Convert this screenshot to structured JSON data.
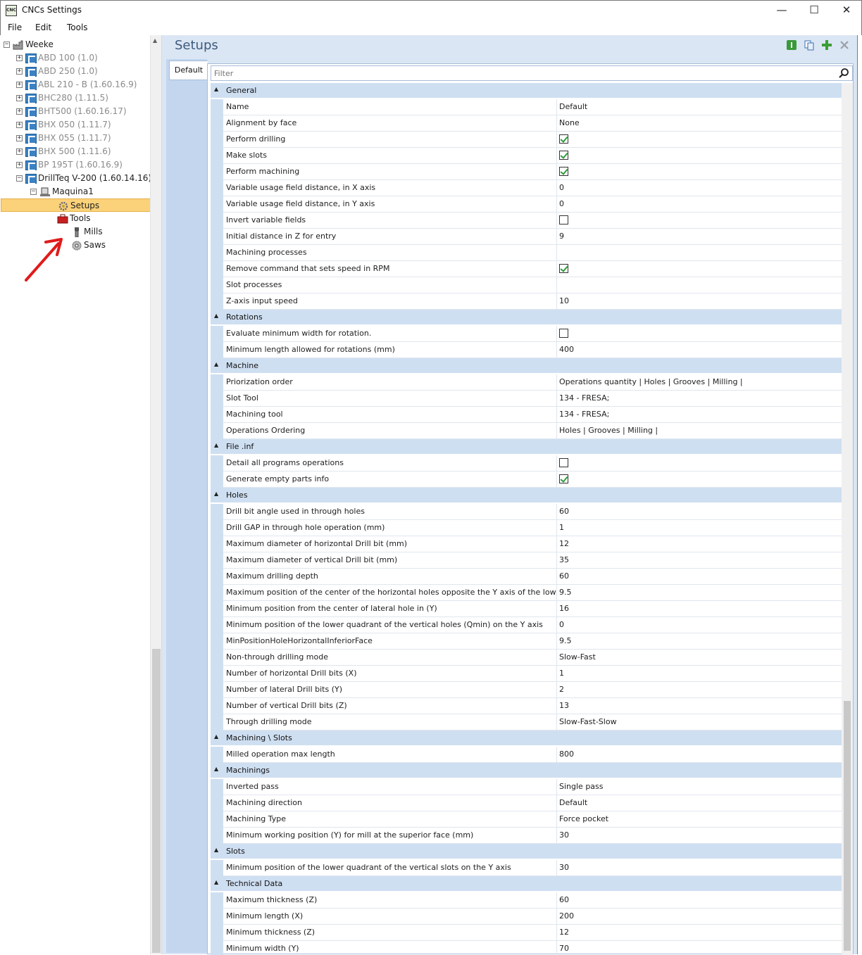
{
  "window": {
    "title": "CNCs Settings",
    "icon_text": "CNC"
  },
  "menu": [
    "File",
    "Edit",
    "Tools"
  ],
  "tree": [
    {
      "label": "Weeke",
      "level": 0,
      "expander": "−",
      "icon": "factory-icon",
      "disabled": false
    },
    {
      "label": "ABD 100 (1.0)",
      "level": 1,
      "expander": "+",
      "icon": "cnc-icon",
      "disabled": true
    },
    {
      "label": "ABD 250 (1.0)",
      "level": 1,
      "expander": "+",
      "icon": "cnc-icon",
      "disabled": true
    },
    {
      "label": "ABL 210 - B (1.60.16.9)",
      "level": 1,
      "expander": "+",
      "icon": "cnc-icon",
      "disabled": true
    },
    {
      "label": "BHC280 (1.11.5)",
      "level": 1,
      "expander": "+",
      "icon": "cnc-icon",
      "disabled": true
    },
    {
      "label": "BHT500 (1.60.16.17)",
      "level": 1,
      "expander": "+",
      "icon": "cnc-icon",
      "disabled": true
    },
    {
      "label": "BHX 050 (1.11.7)",
      "level": 1,
      "expander": "+",
      "icon": "cnc-icon",
      "disabled": true
    },
    {
      "label": "BHX 055 (1.11.7)",
      "level": 1,
      "expander": "+",
      "icon": "cnc-icon",
      "disabled": true
    },
    {
      "label": "BHX 500 (1.11.6)",
      "level": 1,
      "expander": "+",
      "icon": "cnc-icon",
      "disabled": true
    },
    {
      "label": "BP 195T (1.60.16.9)",
      "level": 1,
      "expander": "+",
      "icon": "cnc-icon",
      "disabled": true
    },
    {
      "label": "DrillTeq V-200 (1.60.14.16)",
      "level": 1,
      "expander": "−",
      "icon": "cnc-icon",
      "disabled": false
    },
    {
      "label": "Maquina1",
      "level": 2,
      "expander": "−",
      "icon": "machine-icon",
      "disabled": false
    },
    {
      "label": "Setups",
      "level": 3,
      "expander": "",
      "icon": "gear-icon",
      "disabled": false,
      "selected": true
    },
    {
      "label": "Tools",
      "level": 3,
      "expander": "",
      "icon": "toolbox-icon",
      "disabled": false
    },
    {
      "label": "Mills",
      "level": 4,
      "expander": "",
      "icon": "mill-icon",
      "disabled": false
    },
    {
      "label": "Saws",
      "level": 4,
      "expander": "",
      "icon": "saw-icon",
      "disabled": false
    }
  ],
  "main": {
    "title": "Setups",
    "tab": "Default",
    "filter_placeholder": "Filter",
    "toolbar": [
      "info-icon",
      "copy-icon",
      "add-icon",
      "delete-icon"
    ]
  },
  "properties": [
    {
      "category": "General",
      "rows": [
        {
          "name": "Name",
          "value": "Default"
        },
        {
          "name": "Alignment by face",
          "value": "None"
        },
        {
          "name": "Perform drilling",
          "check": true
        },
        {
          "name": "Make slots",
          "check": true
        },
        {
          "name": "Perform machining",
          "check": true
        },
        {
          "name": "Variable usage field distance, in X axis",
          "value": "0"
        },
        {
          "name": "Variable usage field distance, in Y axis",
          "value": "0"
        },
        {
          "name": "Invert variable fields",
          "check": false
        },
        {
          "name": "Initial distance in Z for entry",
          "value": "9"
        },
        {
          "name": "Machining processes",
          "value": ""
        },
        {
          "name": "Remove command that sets speed in RPM",
          "check": true
        },
        {
          "name": "Slot processes",
          "value": ""
        },
        {
          "name": "Z-axis input speed",
          "value": "10"
        }
      ]
    },
    {
      "category": "Rotations",
      "rows": [
        {
          "name": "Evaluate minimum width for rotation.",
          "check": false
        },
        {
          "name": "Minimum length allowed for rotations (mm)",
          "value": "400"
        }
      ]
    },
    {
      "category": "Machine",
      "rows": [
        {
          "name": "Priorization order",
          "value": "Operations quantity | Holes | Grooves | Milling |"
        },
        {
          "name": "Slot Tool",
          "value": "134 - FRESA;"
        },
        {
          "name": "Machining tool",
          "value": "134 - FRESA;"
        },
        {
          "name": "Operations Ordering",
          "value": "Holes | Grooves | Milling |"
        }
      ]
    },
    {
      "category": "File .inf",
      "rows": [
        {
          "name": "Detail all programs operations",
          "check": false
        },
        {
          "name": "Generate empty parts info",
          "check": true
        }
      ]
    },
    {
      "category": "Holes",
      "rows": [
        {
          "name": "Drill bit angle used in through holes",
          "value": "60"
        },
        {
          "name": "Drill GAP in through hole operation (mm)",
          "value": "1"
        },
        {
          "name": "Maximum diameter of horizontal Drill bit (mm)",
          "value": "12"
        },
        {
          "name": "Maximum diameter of vertical Drill bit (mm)",
          "value": "35"
        },
        {
          "name": "Maximum drilling depth",
          "value": "60"
        },
        {
          "name": "Maximum position of the center of the horizontal holes opposite the Y axis of the lower face",
          "value": "9.5"
        },
        {
          "name": "Minimum position from the center of lateral hole in (Y)",
          "value": "16"
        },
        {
          "name": "Minimum position of the lower quadrant of the vertical holes (Qmin) on the Y axis",
          "value": "0"
        },
        {
          "name": "MinPositionHoleHorizontalInferiorFace",
          "value": "9.5"
        },
        {
          "name": "Non-through drilling mode",
          "value": "Slow-Fast"
        },
        {
          "name": "Number of horizontal Drill bits (X)",
          "value": "1"
        },
        {
          "name": "Number of lateral Drill bits (Y)",
          "value": "2"
        },
        {
          "name": "Number of vertical Drill bits (Z)",
          "value": "13"
        },
        {
          "name": "Through drilling mode",
          "value": "Slow-Fast-Slow"
        }
      ]
    },
    {
      "category": "Machining \\ Slots",
      "rows": [
        {
          "name": "Milled operation max length",
          "value": "800"
        }
      ]
    },
    {
      "category": "Machinings",
      "rows": [
        {
          "name": "Inverted pass",
          "value": "Single pass"
        },
        {
          "name": "Machining direction",
          "value": "Default"
        },
        {
          "name": "Machining Type",
          "value": "Force pocket"
        },
        {
          "name": "Minimum working position (Y) for mill at the superior face (mm)",
          "value": "30"
        }
      ]
    },
    {
      "category": "Slots",
      "rows": [
        {
          "name": "Minimum position of the lower quadrant of the vertical slots on the Y axis",
          "value": "30"
        }
      ]
    },
    {
      "category": "Technical Data",
      "rows": [
        {
          "name": "Maximum thickness (Z)",
          "value": "60"
        },
        {
          "name": "Minimum length (X)",
          "value": "200"
        },
        {
          "name": "Minimum thickness (Z)",
          "value": "12"
        },
        {
          "name": "Minimum width (Y)",
          "value": "70"
        }
      ]
    }
  ]
}
